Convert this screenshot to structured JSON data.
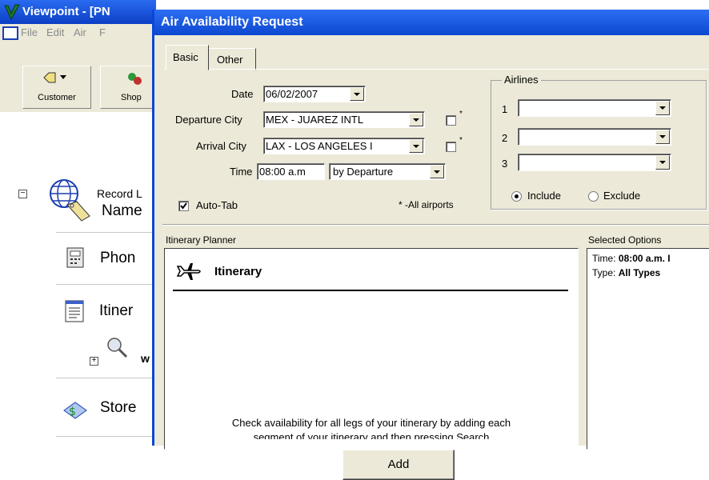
{
  "bg_window": {
    "title": "Viewpoint - [PN",
    "menu": [
      "File",
      "Edit",
      "Air",
      "F"
    ],
    "toolbar": [
      {
        "label": "Customer",
        "icon": "customer-tag-icon"
      },
      {
        "label": "Shop",
        "icon": "shop-icon"
      }
    ],
    "tree_root_label": "Record L",
    "nav_items": [
      {
        "label": "Name",
        "icon": "name-tag-icon"
      },
      {
        "label": "Phon",
        "icon": "phone-icon"
      },
      {
        "label": "Itiner",
        "icon": "itinerary-document-icon"
      },
      {
        "label": "Store",
        "icon": "stored-fare-icon"
      }
    ],
    "sub_item_label": "w"
  },
  "dialog": {
    "title": "Air Availability Request",
    "tabs": [
      {
        "label": "Basic",
        "active": true
      },
      {
        "label": "Other",
        "active": false
      }
    ],
    "date_label": "Date",
    "date_value": "06/02/2007",
    "departure_label": "Departure City",
    "departure_value": "MEX - JUAREZ INTL",
    "arrival_label": "Arrival City",
    "arrival_value": "LAX - LOS ANGELES I",
    "time_label": "Time",
    "time_value": "08:00 a.m",
    "time_mode_value": "by Departure",
    "asterisk": "*",
    "auto_tab_label": "Auto-Tab",
    "auto_tab_checked": true,
    "all_airports_note": "* -All airports",
    "airlines": {
      "legend": "Airlines",
      "rows": [
        {
          "num": "1",
          "value": ""
        },
        {
          "num": "2",
          "value": ""
        },
        {
          "num": "3",
          "value": ""
        }
      ],
      "include_label": "Include",
      "exclude_label": "Exclude",
      "selected": "Include"
    },
    "itinerary_planner": {
      "label": "Itinerary Planner",
      "heading": "Itinerary",
      "help_line1": "Check availability for all legs of your itinerary by adding each",
      "help_line2": "segment of your itinerary and then pressing Search"
    },
    "selected_options": {
      "label": "Selected Options",
      "time_prefix": "Time:",
      "time_value": "08:00 a.m. I",
      "type_prefix": "Type:",
      "type_value": "All Types"
    }
  },
  "add_button_label": "Add"
}
